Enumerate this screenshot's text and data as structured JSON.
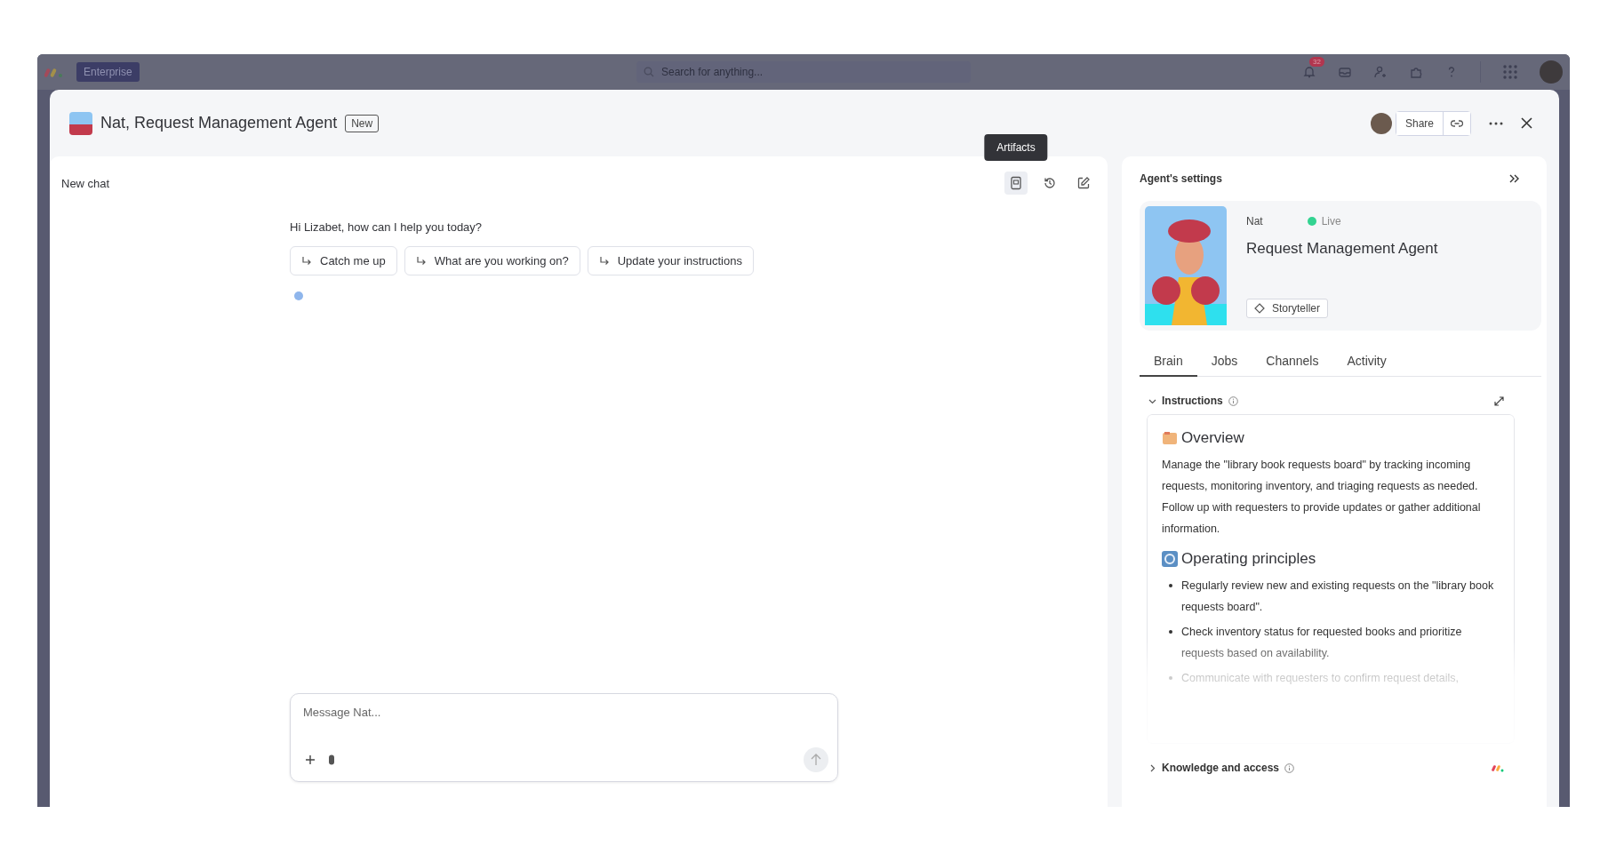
{
  "top_bar": {
    "workspace_badge": "Enterprise",
    "search": {
      "placeholder": "Search for anything..."
    },
    "notification_count": "32"
  },
  "header": {
    "title": "Nat, Request Management Agent",
    "badge": "New",
    "share_label": "Share"
  },
  "chat": {
    "title": "New chat",
    "tooltip": "Artifacts",
    "greeting": "Hi Lizabet, how can I help you today?",
    "suggestions": [
      "Catch me up",
      "What are you working on?",
      "Update your instructions"
    ],
    "message": {
      "placeholder": "Message Nat..."
    }
  },
  "settings": {
    "title": "Agent's settings",
    "agent": {
      "name": "Nat",
      "live": true,
      "status": "Live",
      "role": "Request Management Agent",
      "tag": "Storyteller"
    },
    "tabs": [
      {
        "label": "Brain",
        "selected": true
      },
      {
        "label": "Jobs",
        "selected": false
      },
      {
        "label": "Channels",
        "selected": false
      },
      {
        "label": "Activity",
        "selected": false
      }
    ],
    "sections": [
      {
        "title": "Instructions",
        "expanded": true,
        "content": [
          {
            "kind": "heading",
            "text": "Overview"
          },
          {
            "kind": "paragraph",
            "text": "Manage the \"library book requests board\" by tracking incoming requests, monitoring inventory, and triaging requests as needed. Follow up with requesters to provide updates or gather additional information."
          },
          {
            "kind": "heading",
            "text": "Operating principles"
          },
          {
            "kind": "bullets",
            "items": [
              "Regularly review new and existing requests on the \"library book requests board\".",
              "Check inventory status for requested books and prioritize requests based on availability.",
              "Communicate with requesters to confirm request details,"
            ]
          }
        ]
      },
      {
        "title": "Knowledge and access",
        "expanded": false
      }
    ]
  }
}
